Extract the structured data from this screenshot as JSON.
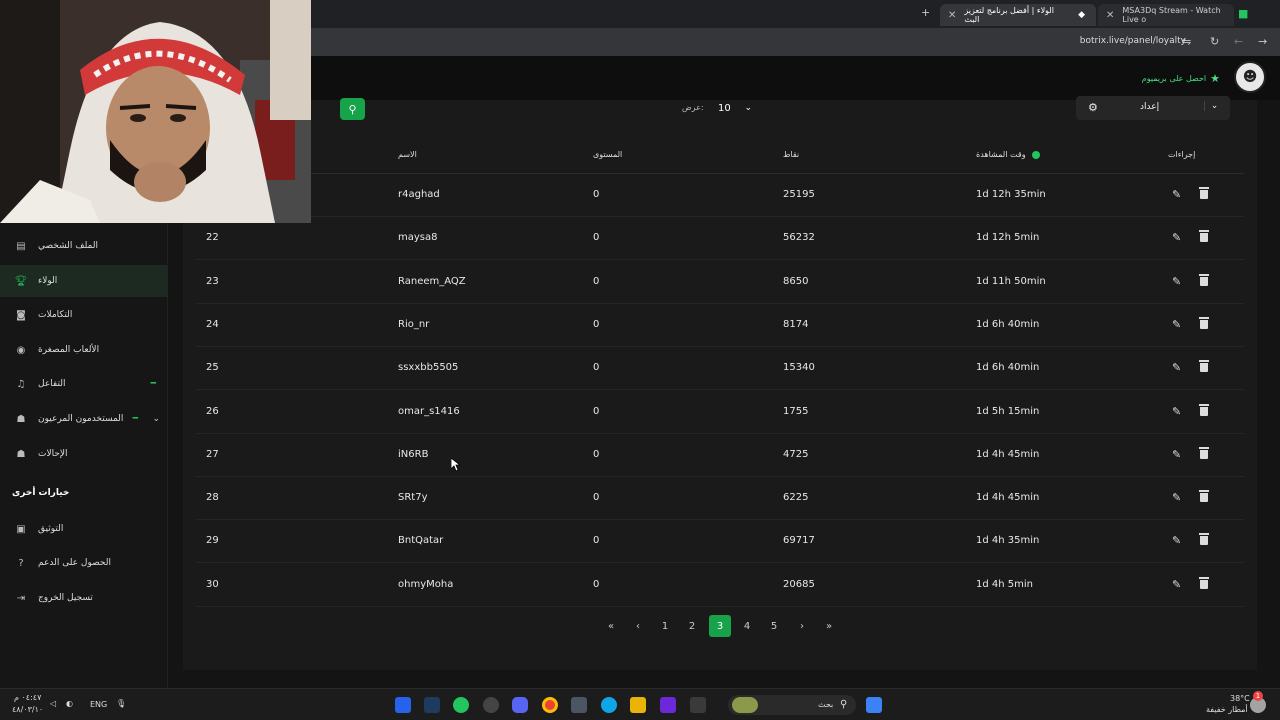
{
  "browser": {
    "tabs": [
      {
        "title": "MSA3Dq Stream - Watch Live o",
        "active": false
      },
      {
        "title": "الولاء | أفضل برنامج لتعزيز البث",
        "active": true
      }
    ],
    "url": "botrix.live/panel/loyalty"
  },
  "header": {
    "premium_label": "احصل على بريميوم"
  },
  "sidebar": {
    "items": [
      {
        "label": "الملف الشخصي",
        "icon": "id-card-icon"
      },
      {
        "label": "الولاء",
        "icon": "trophy-icon",
        "active": true
      },
      {
        "label": "التكاملات",
        "icon": "puzzle-icon"
      },
      {
        "label": "الألعاب المصغرة",
        "icon": "gamepad-icon"
      },
      {
        "label": "التفاعل",
        "icon": "music-icon"
      },
      {
        "label": "المستخدمون المرعيون",
        "icon": "users-icon"
      },
      {
        "label": "الإحالات",
        "icon": "user-group-icon"
      }
    ],
    "section_other": "خيارات أخرى",
    "other_items": [
      {
        "label": "التوثيق",
        "icon": "book-icon"
      },
      {
        "label": "الحصول على الدعم",
        "icon": "help-icon"
      },
      {
        "label": "تسجيل الخروج",
        "icon": "logout-icon"
      }
    ]
  },
  "toolbar": {
    "show_label": "عرض:",
    "show_value": "10",
    "settings_label": "إعداد"
  },
  "table": {
    "headers": {
      "name": "الاسم",
      "level": "المستوى",
      "points": "نقاط",
      "watch_time": "وقت المشاهدة",
      "actions": "إجراءات"
    },
    "rows": [
      {
        "num": "",
        "name": "r4aghad",
        "level": "0",
        "points": "25195",
        "time": "1d 12h 35min"
      },
      {
        "num": "22",
        "name": "maysa8",
        "level": "0",
        "points": "56232",
        "time": "1d 12h 5min"
      },
      {
        "num": "23",
        "name": "Raneem_AQZ",
        "level": "0",
        "points": "8650",
        "time": "1d 11h 50min"
      },
      {
        "num": "24",
        "name": "Rio_nr",
        "level": "0",
        "points": "8174",
        "time": "1d 6h 40min"
      },
      {
        "num": "25",
        "name": "ssxxbb5505",
        "level": "0",
        "points": "15340",
        "time": "1d 6h 40min"
      },
      {
        "num": "26",
        "name": "omar_s1416",
        "level": "0",
        "points": "1755",
        "time": "1d 5h 15min"
      },
      {
        "num": "27",
        "name": "iN6RB",
        "level": "0",
        "points": "4725",
        "time": "1d 4h 45min"
      },
      {
        "num": "28",
        "name": "SRt7y",
        "level": "0",
        "points": "6225",
        "time": "1d 4h 45min"
      },
      {
        "num": "29",
        "name": "BntQatar",
        "level": "0",
        "points": "69717",
        "time": "1d 4h 35min"
      },
      {
        "num": "30",
        "name": "ohmyMoha",
        "level": "0",
        "points": "20685",
        "time": "1d 4h 5min"
      }
    ]
  },
  "pagination": {
    "pages": [
      "1",
      "2",
      "3",
      "4",
      "5"
    ],
    "current": "3"
  },
  "taskbar": {
    "search_placeholder": "بحث",
    "lang": "ENG",
    "time": "٠٤:٤٧ م",
    "date": "٤٨/٠٣/١٠",
    "weather_temp": "38°C",
    "weather_desc": "أمطار خفيفة",
    "notif_count": "1"
  },
  "colors": {
    "accent": "#16a34a",
    "bg": "#141414",
    "panel": "#1a1a1a"
  }
}
